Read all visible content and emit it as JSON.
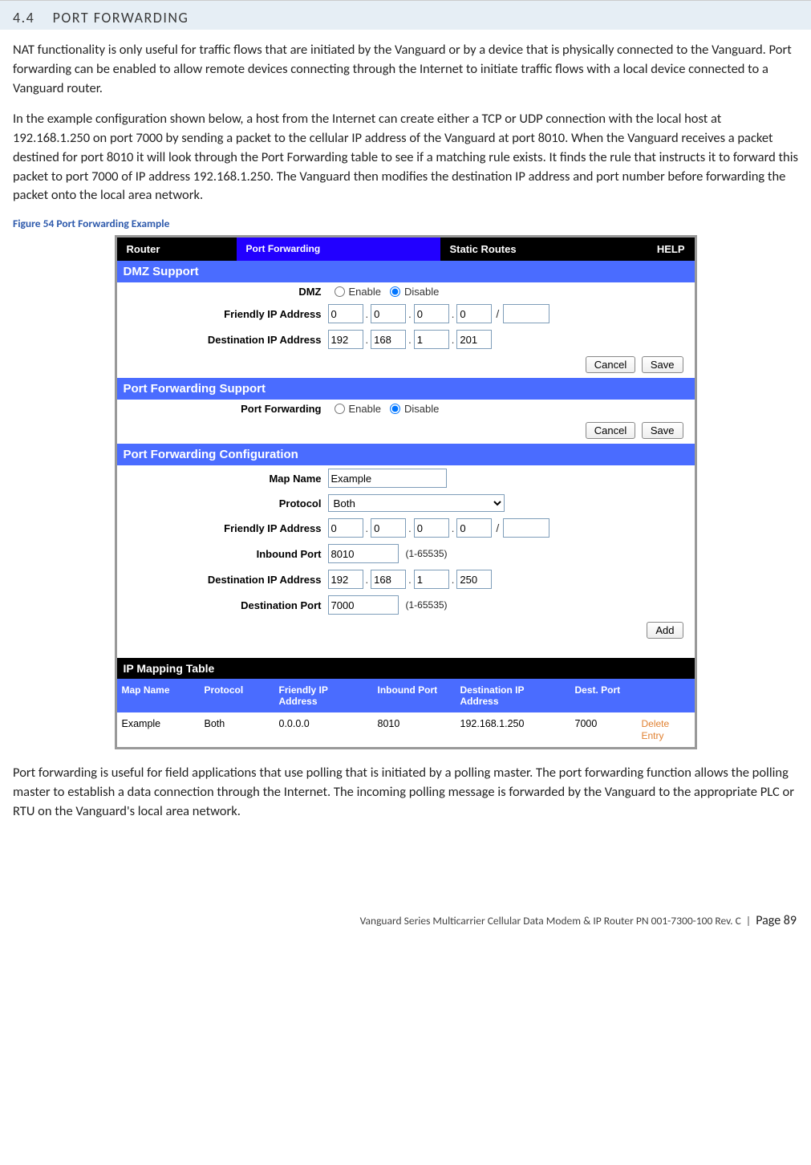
{
  "section": {
    "number": "4.4",
    "title": "PORT FORWARDING"
  },
  "paragraphs": {
    "p1": "NAT functionality is only useful for traffic flows that are initiated by the Vanguard or by a device that is physically connected to the Vanguard. Port forwarding can be enabled to allow remote devices connecting through the Internet to initiate traffic flows with a local device connected to a Vanguard router.",
    "p2": "In the example configuration shown below, a host from the Internet can create either a TCP or UDP connection with the local host at 192.168.1.250 on port 7000 by sending a packet to the cellular IP address of the Vanguard at port 8010. When the Vanguard receives a packet destined for port 8010 it will look through the Port Forwarding table to see if a matching rule exists. It finds the rule that instructs it to forward this packet to port 7000 of IP address 192.168.1.250. The Vanguard then modifies the destination IP address and port number before forwarding the packet onto the local area network.",
    "p3": "Port forwarding is useful for field applications that use polling that is initiated by a polling master. The port forwarding function allows the polling master to establish a data connection through the Internet. The incoming polling message is forwarded by the Vanguard to the appropriate PLC or RTU on the Vanguard's local area network."
  },
  "figure_caption": "Figure 54 Port Forwarding Example",
  "ui": {
    "tabs": {
      "router": "Router",
      "pf": "Port Forwarding",
      "static": "Static Routes",
      "help": "HELP"
    },
    "sec_dmz": "DMZ Support",
    "dmz_label": "DMZ",
    "enable": "Enable",
    "disable": "Disable",
    "friendly_ip": "Friendly IP Address",
    "dest_ip": "Destination IP Address",
    "cancel": "Cancel",
    "save": "Save",
    "sec_pfs": "Port Forwarding Support",
    "pf_label": "Port Forwarding",
    "sec_pfc": "Port Forwarding Configuration",
    "map_name": "Map Name",
    "protocol": "Protocol",
    "inbound_port": "Inbound Port",
    "dest_port": "Destination Port",
    "range_hint": "(1-65535)",
    "add": "Add",
    "sec_ipmap": "IP Mapping Table",
    "tbl": {
      "map": "Map Name",
      "prot": "Protocol",
      "fip": "Friendly IP Address",
      "inp": "Inbound Port",
      "dip": "Destination IP Address",
      "dp": "Dest. Port"
    },
    "values": {
      "dmz_fip": [
        "0",
        "0",
        "0",
        "0"
      ],
      "dmz_cidr": "",
      "dmz_dip": [
        "192",
        "168",
        "1",
        "201"
      ],
      "pfc_map": "Example",
      "pfc_proto": "Both",
      "pfc_fip": [
        "0",
        "0",
        "0",
        "0"
      ],
      "pfc_cidr": "",
      "pfc_inport": "8010",
      "pfc_dip": [
        "192",
        "168",
        "1",
        "250"
      ],
      "pfc_dport": "7000"
    },
    "row": {
      "map": "Example",
      "prot": "Both",
      "fip": "0.0.0.0",
      "inp": "8010",
      "dip": "192.168.1.250",
      "dp": "7000",
      "del": "Delete Entry"
    }
  },
  "footer": {
    "line": "Vanguard Series Multicarrier Cellular Data Modem & IP Router PN 001-7300-100 Rev. C",
    "page": "Page 89"
  }
}
